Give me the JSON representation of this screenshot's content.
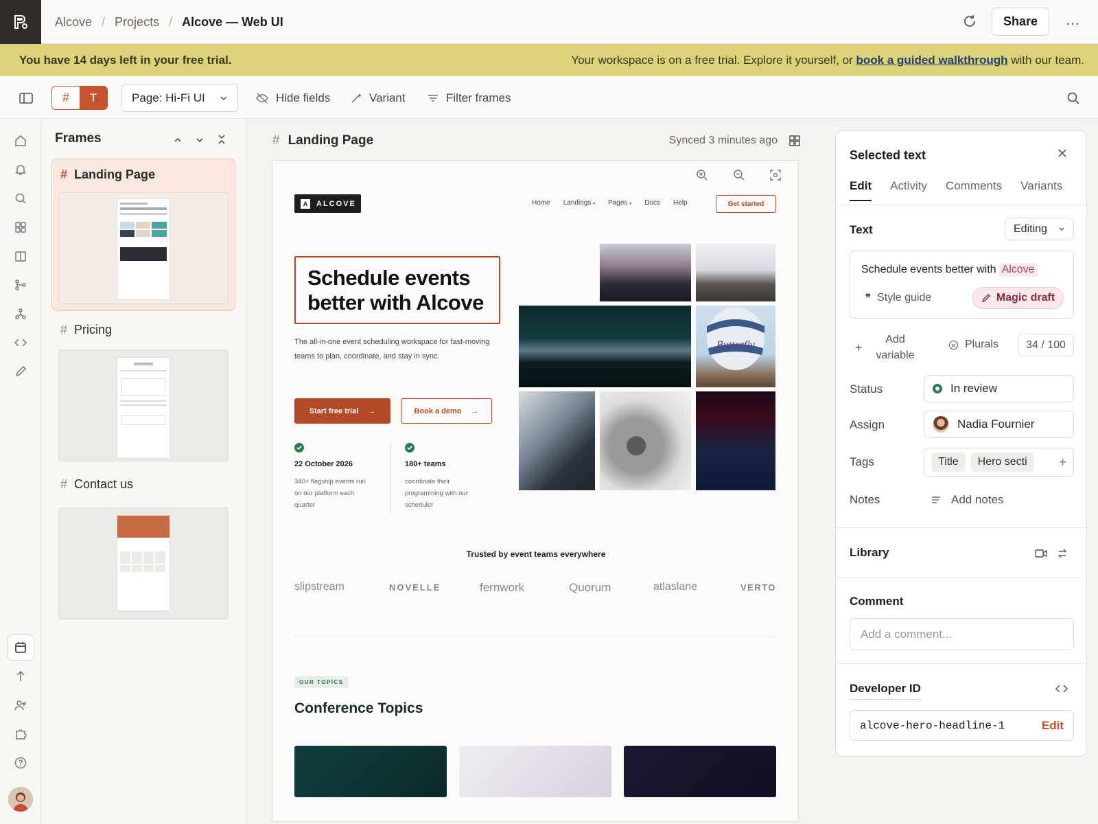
{
  "breadcrumb": {
    "root": "Alcove",
    "projects": "Projects",
    "current": "Alcove — Web UI"
  },
  "topbar": {
    "share": "Share"
  },
  "banner": {
    "left": "You have 14 days left in your free trial.",
    "right_pre": "Your workspace is on a free trial. Explore it yourself, or",
    "link": "book a guided walkthrough",
    "right_post": "with our team."
  },
  "toolbar": {
    "page_select": "Page: Hi-Fi UI",
    "hide_fields": "Hide fields",
    "variant": "Variant",
    "filter": "Filter frames"
  },
  "frames": {
    "title": "Frames",
    "items": [
      {
        "label": "Landing Page"
      },
      {
        "label": "Pricing"
      },
      {
        "label": "Contact us"
      }
    ]
  },
  "canvas": {
    "frame_title": "Landing Page",
    "synced": "Synced 3 minutes ago"
  },
  "site": {
    "brand": "ALCOVE",
    "brand_mark": "A",
    "nav": [
      "Home",
      "Landings",
      "Pages",
      "Docs",
      "Help"
    ],
    "cta_nav": "Get started",
    "headline": "Schedule events better with Alcove",
    "sub": "The all-in-one event scheduling workspace for fast-moving teams to plan, coordinate, and stay in sync.",
    "btn_primary": "Start free trial",
    "btn_secondary": "Book a demo",
    "stat1": {
      "title": "22 October 2026",
      "desc": "340+ flagship events run on our platform each quarter"
    },
    "stat2": {
      "title": "180+ teams",
      "desc": "coordinate their programming with our scheduler"
    },
    "trusted": "Trusted by event teams everywhere",
    "logos": [
      "slipstream",
      "NOVELLE",
      "fernwork",
      "Quorum",
      "atlaslane",
      "VERTO"
    ],
    "topics_badge": "OUR TOPICS",
    "topics_title": "Conference Topics",
    "balloon_text": "Butterfly"
  },
  "panel": {
    "title": "Selected text",
    "tabs": [
      "Edit",
      "Activity",
      "Comments",
      "Variants"
    ],
    "text_label": "Text",
    "mode": "Editing",
    "text_value": "Schedule events better with",
    "text_highlight": "Alcove",
    "style_guide": "Style guide",
    "magic_draft": "Magic draft",
    "add_variable": "Add variable",
    "plurals": "Plurals",
    "count": "34 / 100",
    "status_label": "Status",
    "status": "In review",
    "assign_label": "Assign",
    "assignee": "Nadia Fournier",
    "tags_label": "Tags",
    "tags": [
      "Title",
      "Hero secti"
    ],
    "notes_label": "Notes",
    "notes_action": "Add notes",
    "library": "Library",
    "comment": "Comment",
    "comment_placeholder": "Add a comment...",
    "dev_id_label": "Developer ID",
    "dev_id": "alcove-hero-headline-1",
    "edit": "Edit"
  },
  "colors": {
    "accent": "#c4532f",
    "banner": "#dcd27a",
    "status_green": "#2f7a4f"
  }
}
